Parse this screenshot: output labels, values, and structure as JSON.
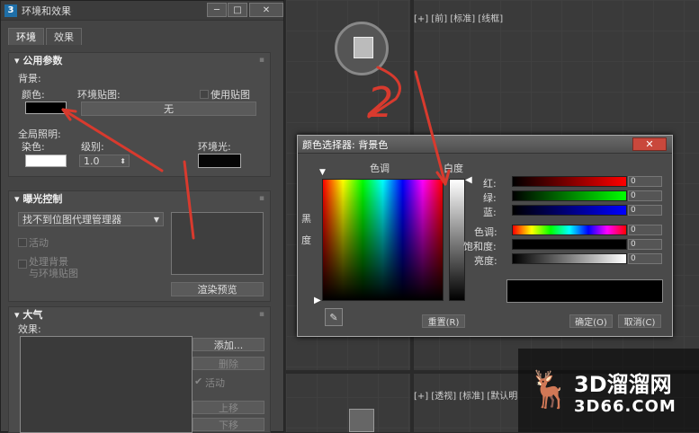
{
  "viewport": {
    "top_right_label": "[+] [前] [标准] [线框]",
    "bottom_label": "[+] [透视] [标准] [默认明"
  },
  "env_window": {
    "app_icon": "3",
    "title": "环境和效果",
    "tabs": [
      {
        "label": "环境"
      },
      {
        "label": "效果"
      }
    ],
    "common": {
      "header": "公用参数",
      "background_label": "背景:",
      "color_label": "颜色:",
      "env_map_label": "环境贴图:",
      "use_map_label": "使用贴图",
      "env_map_value": "无",
      "global_light_label": "全局照明:",
      "tint_label": "染色:",
      "level_label": "级别:",
      "level_value": "1.0",
      "ambient_label": "环境光:"
    },
    "exposure": {
      "header": "曝光控制",
      "dropdown_value": "找不到位图代理管理器",
      "active_label": "活动",
      "process_label_1": "处理背景",
      "process_label_2": "与环境贴图",
      "render_preview": "渲染预览"
    },
    "atmosphere": {
      "header": "大气",
      "effects_label": "效果:",
      "add": "添加...",
      "delete": "删除",
      "active": "活动",
      "up": "上移",
      "down": "下移"
    }
  },
  "picker": {
    "title": "颜色选择器: 背景色",
    "close": "✕",
    "hue_label": "色调",
    "white_label": "白度",
    "black_label_1": "黑",
    "black_label_2": "度",
    "reset": "重置(R)",
    "ok": "确定(O)",
    "cancel": "取消(C)",
    "channels": [
      {
        "label": "红:",
        "value": "0"
      },
      {
        "label": "绿:",
        "value": "0"
      },
      {
        "label": "蓝:",
        "value": "0"
      },
      {
        "label": "色调:",
        "value": "0"
      },
      {
        "label": "饱和度:",
        "value": "0"
      },
      {
        "label": "亮度:",
        "value": "0"
      }
    ]
  },
  "annotation": {
    "number": "2"
  },
  "watermark": {
    "line1": "3D溜溜网",
    "line2": "3D66.COM"
  },
  "colors": {
    "arrow": "#d83a2e",
    "close": "#c9483c"
  }
}
